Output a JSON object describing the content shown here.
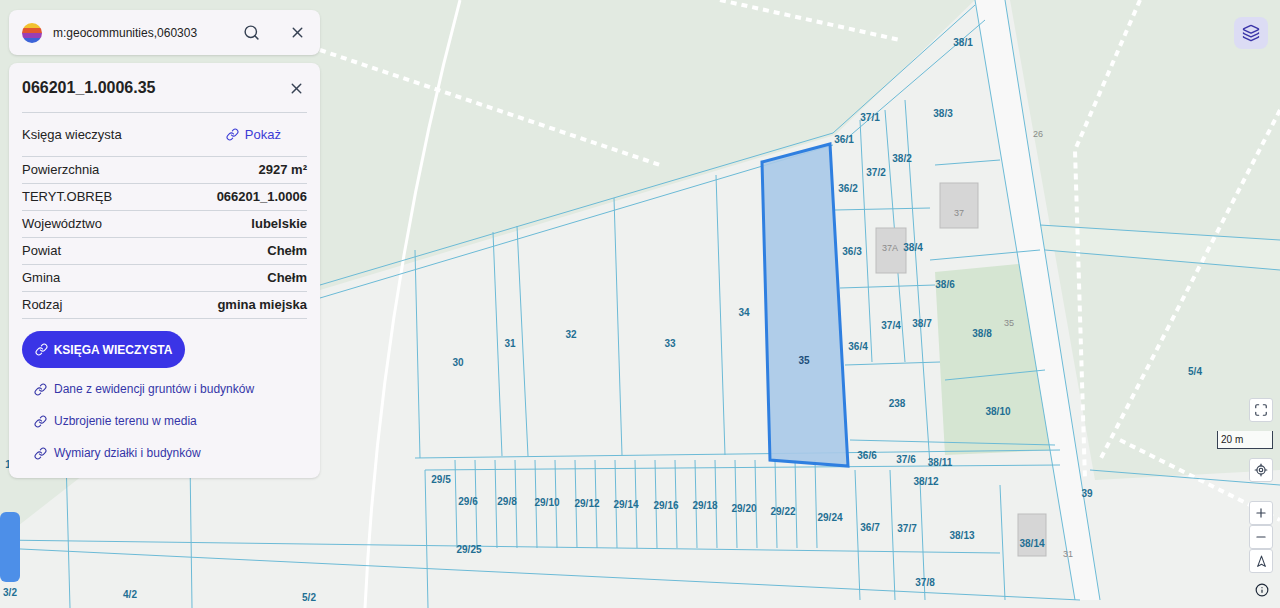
{
  "search": {
    "query": "m:geocommunities,060303"
  },
  "parcel_panel": {
    "title": "066201_1.0006.35",
    "rows": [
      {
        "label": "Księga wieczysta",
        "value": "Pokaż",
        "kind": "link"
      },
      {
        "label": "Powierzchnia",
        "value": "2927 m²",
        "kind": "value"
      },
      {
        "label": "TERYT.OBRĘB",
        "value": "066201_1.0006",
        "kind": "value"
      },
      {
        "label": "Województwo",
        "value": "lubelskie",
        "kind": "value"
      },
      {
        "label": "Powiat",
        "value": "Chełm",
        "kind": "value"
      },
      {
        "label": "Gmina",
        "value": "Chełm",
        "kind": "value"
      },
      {
        "label": "Rodzaj",
        "value": "gmina miejska",
        "kind": "value"
      }
    ],
    "primary_button": "KSIĘGA WIECZYSTA",
    "links": [
      "Dane z ewidencji gruntów i budynków",
      "Uzbrojenie terenu w media",
      "Wymiary działki i budynków"
    ]
  },
  "map": {
    "parcels": [
      {
        "label": "38/1",
        "selected": false
      },
      {
        "label": "37/1",
        "selected": false
      },
      {
        "label": "38/3",
        "selected": false
      },
      {
        "label": "36/1",
        "selected": false
      },
      {
        "label": "38/2",
        "selected": false
      },
      {
        "label": "37/2",
        "selected": false
      },
      {
        "label": "36/2",
        "selected": false
      },
      {
        "label": "36/3",
        "selected": false
      },
      {
        "label": "38/4",
        "selected": false
      },
      {
        "label": "38/6",
        "selected": false
      },
      {
        "label": "37/4",
        "selected": false
      },
      {
        "label": "38/7",
        "selected": false
      },
      {
        "label": "38/8",
        "selected": false
      },
      {
        "label": "36/4",
        "selected": false
      },
      {
        "label": "35",
        "selected": true
      },
      {
        "label": "34",
        "selected": false
      },
      {
        "label": "33",
        "selected": false
      },
      {
        "label": "32",
        "selected": false
      },
      {
        "label": "31",
        "selected": false
      },
      {
        "label": "30",
        "selected": false
      },
      {
        "label": "238",
        "selected": false
      },
      {
        "label": "38/10",
        "selected": false
      },
      {
        "label": "5/4",
        "selected": false
      },
      {
        "label": "36/6",
        "selected": false
      },
      {
        "label": "37/6",
        "selected": false
      },
      {
        "label": "38/11",
        "selected": false
      },
      {
        "label": "38/12",
        "selected": false
      },
      {
        "label": "39",
        "selected": false
      },
      {
        "label": "29/5",
        "selected": false
      },
      {
        "label": "29/6",
        "selected": false
      },
      {
        "label": "29/8",
        "selected": false
      },
      {
        "label": "29/10",
        "selected": false
      },
      {
        "label": "29/12",
        "selected": false
      },
      {
        "label": "29/14",
        "selected": false
      },
      {
        "label": "29/16",
        "selected": false
      },
      {
        "label": "29/18",
        "selected": false
      },
      {
        "label": "29/20",
        "selected": false
      },
      {
        "label": "29/22",
        "selected": false
      },
      {
        "label": "29/24",
        "selected": false
      },
      {
        "label": "36/7",
        "selected": false
      },
      {
        "label": "37/7",
        "selected": false
      },
      {
        "label": "38/13",
        "selected": false
      },
      {
        "label": "38/14",
        "selected": false
      },
      {
        "label": "29/25",
        "selected": false
      },
      {
        "label": "37/8",
        "selected": false
      },
      {
        "label": "4/2",
        "selected": false
      },
      {
        "label": "5/2",
        "selected": false
      },
      {
        "label": "1",
        "selected": false
      },
      {
        "label": "3/2",
        "selected": false
      }
    ],
    "house_numbers": [
      "37",
      "37A",
      "35",
      "26",
      "31"
    ],
    "scale": "20 m"
  }
}
